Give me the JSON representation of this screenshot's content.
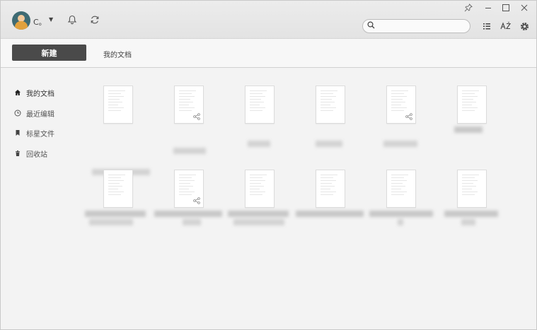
{
  "user": {
    "name": "C。"
  },
  "search": {
    "placeholder": "",
    "value": ""
  },
  "toolbar": {
    "new_label": "新建",
    "breadcrumb": "我的文档"
  },
  "sidebar": {
    "items": [
      {
        "label": "我的文档",
        "icon": "home-icon",
        "active": true
      },
      {
        "label": "最近编辑",
        "icon": "clock-icon",
        "active": false
      },
      {
        "label": "标星文件",
        "icon": "bookmark-icon",
        "active": false
      },
      {
        "label": "回收站",
        "icon": "trash-icon",
        "active": false
      }
    ]
  },
  "files": [
    {
      "shared": false
    },
    {
      "shared": true
    },
    {
      "shared": false
    },
    {
      "shared": false
    },
    {
      "shared": true
    },
    {
      "shared": false
    },
    {
      "shared": false
    },
    {
      "shared": true
    },
    {
      "shared": false
    },
    {
      "shared": false
    },
    {
      "shared": false
    },
    {
      "shared": false
    }
  ],
  "colors": {
    "accent": "#4a4a4a",
    "background": "#f3f3f3",
    "titlebar": "#e6e6e6"
  }
}
